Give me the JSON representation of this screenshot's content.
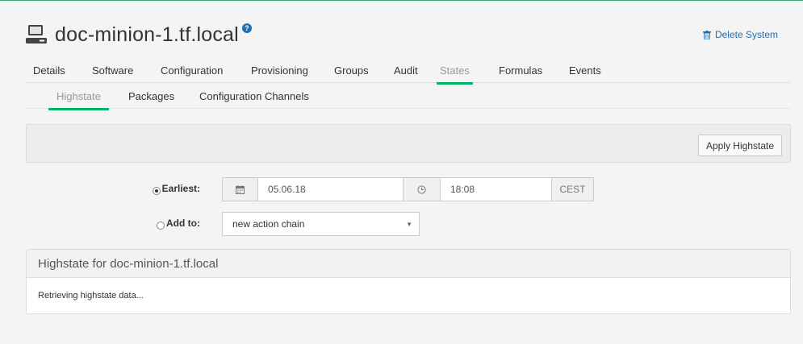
{
  "header": {
    "title": "doc-minion-1.tf.local",
    "help_icon": "question-circle-icon",
    "delete_label": "Delete System",
    "delete_icon": "trash-icon"
  },
  "tabs": [
    "Details",
    "Software",
    "Configuration",
    "Provisioning",
    "Groups",
    "Audit",
    "States",
    "Formulas",
    "Events"
  ],
  "active_tab": "States",
  "subtabs": [
    "Highstate",
    "Packages",
    "Configuration Channels"
  ],
  "active_subtab": "Highstate",
  "toolbar": {
    "apply_label": "Apply Highstate"
  },
  "schedule": {
    "earliest_label": "Earliest:",
    "date": "05.06.18",
    "time": "18:08",
    "timezone": "CEST",
    "calendar_icon": "calendar-icon",
    "clock_icon": "clock-icon",
    "add_to_label": "Add to:",
    "action_chain_value": "new action chain"
  },
  "panel": {
    "heading": "Highstate for doc-minion-1.tf.local",
    "body": "Retrieving highstate data..."
  },
  "colors": {
    "accent": "#00b36b",
    "link": "#1f6fb2"
  }
}
